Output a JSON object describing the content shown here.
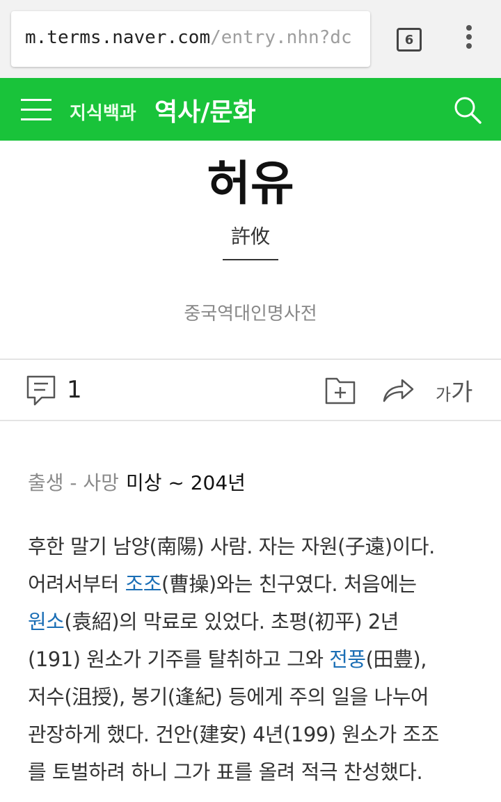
{
  "browser": {
    "url_host": "m.terms.naver.com",
    "url_path": "/entry.nhn?dc",
    "tab_count": "6"
  },
  "header": {
    "brand_small": "지식백과",
    "brand_big": "역사/문화"
  },
  "entry": {
    "title": "허유",
    "hanja": "許攸",
    "source": "중국역대인명사전"
  },
  "toolbar": {
    "comment_count": "1",
    "font_label_small": "가",
    "font_label_big": "가"
  },
  "meta": {
    "label": "출생 - 사망",
    "value": "미상 ~ 204년"
  },
  "body": {
    "line1": "후한 말기 남양(南陽) 사람. 자는 자원(子遠)이다.",
    "line2_pre": "어려서부터 ",
    "line2_link": "조조",
    "line2_post": "(曹操)와는 친구였다. 처음에는",
    "line3_link": "원소",
    "line3_post": "(袁紹)의 막료로 있었다. 초평(初平) 2년",
    "line4_pre": "(191) 원소가 기주를 탈취하고 그와 ",
    "line4_link": "전풍",
    "line4_post": "(田豊),",
    "line5": "저수(沮授), 봉기(逢紀) 등에게 주의 일을 나누어",
    "line6": "관장하게 했다. 건안(建安) 4년(199) 원소가 조조",
    "line7": "를 토벌하려 하니 그가 표를 올려 적극 찬성했다."
  },
  "colors": {
    "header_green": "#19c33a",
    "link_blue": "#1a6eb5"
  }
}
